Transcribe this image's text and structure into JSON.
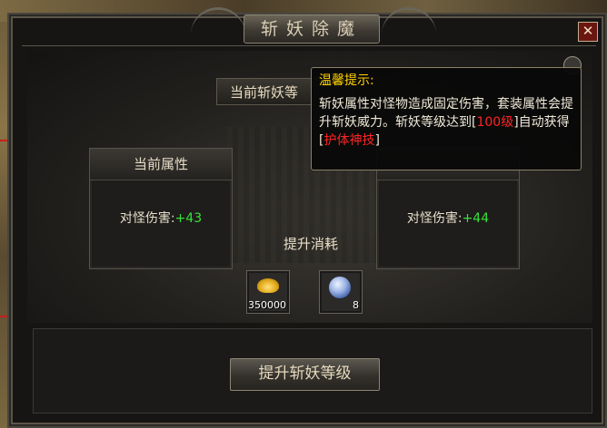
{
  "window": {
    "title": "斩妖除魔",
    "close_glyph": "✕"
  },
  "section": {
    "header": "当前斩妖等"
  },
  "current_stats": {
    "heading": "当前属性",
    "label": "对怪伤害:",
    "value": "+43"
  },
  "next_stats": {
    "label": "对怪伤害:",
    "value": "+44"
  },
  "cost": {
    "label": "提升消耗",
    "items": [
      {
        "icon": "gold-pile-icon",
        "count": "350000"
      },
      {
        "icon": "blue-stone-icon",
        "count": "8"
      }
    ]
  },
  "upgrade_button": "提升斩妖等级",
  "tooltip": {
    "title": "温馨提示:",
    "text1": "斩妖属性对怪物造成固定伤害，套装属性会提升斩妖威力。斩妖等级达到[",
    "level": "100级",
    "text2": "]自动获得[",
    "skill": "护体神技",
    "text3": "]"
  },
  "colors": {
    "stat_value": "#36e23a",
    "tooltip_title": "#ffd200",
    "tooltip_highlight": "#ff2424"
  }
}
